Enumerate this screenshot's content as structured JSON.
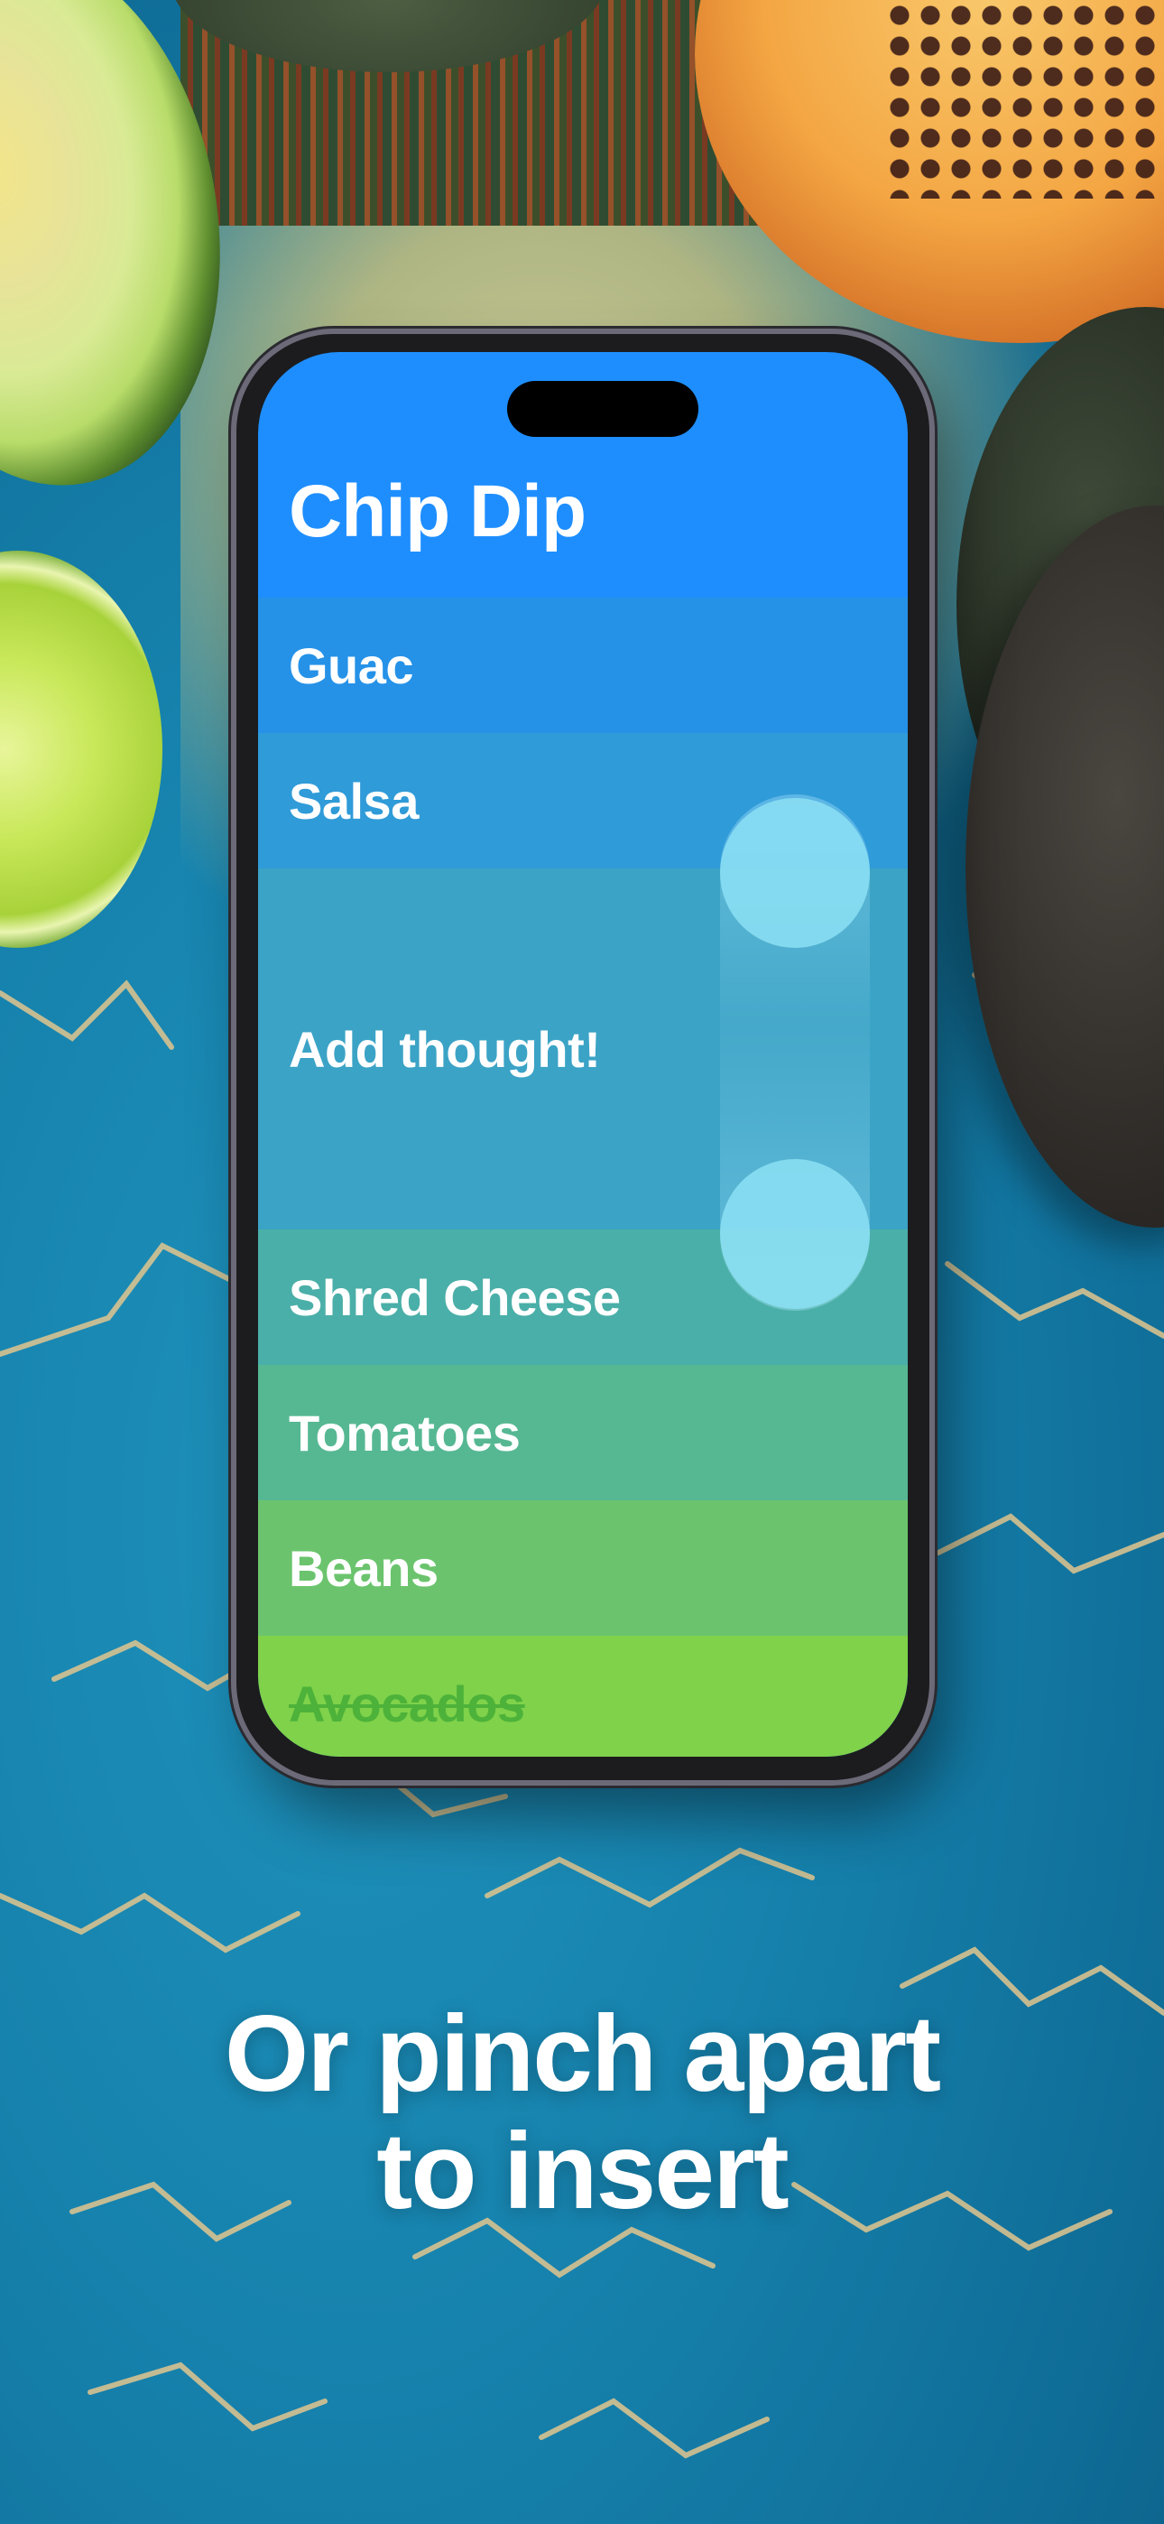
{
  "app": {
    "title": "Chip Dip",
    "items": [
      {
        "label": "Guac",
        "color": "#2592e8",
        "done": false,
        "tall": false
      },
      {
        "label": "Salsa",
        "color": "#2f9bd8",
        "done": false,
        "tall": false
      },
      {
        "label": "Add thought!",
        "color": "#3ba3c6",
        "done": false,
        "tall": true
      },
      {
        "label": "Shred Cheese",
        "color": "#4aafa8",
        "done": false,
        "tall": false
      },
      {
        "label": "Tomatoes",
        "color": "#56b893",
        "done": false,
        "tall": false
      },
      {
        "label": "Beans",
        "color": "#6bc46d",
        "done": false,
        "tall": false
      },
      {
        "label": "Avocados",
        "color": "#7fd24a",
        "done": true,
        "tall": false
      }
    ]
  },
  "gesture": {
    "type": "pinch-apart"
  },
  "caption": {
    "line1": "Or pinch apart",
    "line2": "to insert"
  },
  "colors": {
    "header": "#1e8eff",
    "done_text": "#4db23a",
    "caption": "#ffffff"
  }
}
